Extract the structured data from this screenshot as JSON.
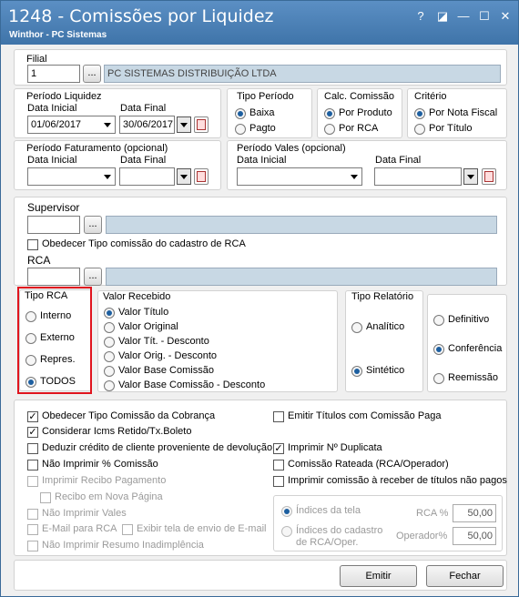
{
  "window": {
    "title": "1248 - Comissões por Liquidez",
    "subtitle": "Winthor - PC Sistemas",
    "help": "?",
    "restore": "◪",
    "minimize": "—",
    "maximize": "☐",
    "close": "✕"
  },
  "filial": {
    "label": "Filial",
    "code": "1",
    "ellipsis": "...",
    "name": "PC SISTEMAS DISTRIBUIÇÃO LTDA"
  },
  "periodo_liquidez": {
    "label": "Período Liquidez",
    "start_label": "Data Inicial",
    "start": "01/06/2017",
    "end_label": "Data Final",
    "end": "30/06/2017"
  },
  "tipo_periodo": {
    "label": "Tipo Período",
    "options": [
      "Baixa",
      "Pagto"
    ],
    "selected": 0
  },
  "calc_comissao": {
    "label": "Calc. Comissão",
    "options": [
      "Por Produto",
      "Por RCA"
    ],
    "selected": 0
  },
  "criterio": {
    "label": "Critério",
    "options": [
      "Por Nota Fiscal",
      "Por Título"
    ],
    "selected": 0
  },
  "periodo_faturamento": {
    "label": "Período Faturamento  (opcional)",
    "start_label": "Data Inicial",
    "end_label": "Data Final"
  },
  "periodo_vales": {
    "label": "Período Vales  (opcional)",
    "start_label": "Data Inicial",
    "end_label": "Data Final"
  },
  "supervisor": {
    "label": "Supervisor",
    "ellipsis": "...",
    "obedecer": "Obedecer Tipo comissão do cadastro de RCA"
  },
  "rca": {
    "label": "RCA",
    "ellipsis": "..."
  },
  "tipo_rca": {
    "label": "Tipo RCA",
    "options": [
      "Interno",
      "Externo",
      "Repres.",
      "TODOS"
    ],
    "selected": 3
  },
  "valor_recebido": {
    "label": "Valor Recebido",
    "options": [
      "Valor Título",
      "Valor Original",
      "Valor Tít. - Desconto",
      "Valor Orig. - Desconto",
      "Valor Base Comissão",
      "Valor Base Comissão - Desconto"
    ],
    "selected": 0
  },
  "tipo_relatorio": {
    "label": "Tipo Relatório",
    "options": [
      "Analítico",
      "Sintético"
    ],
    "selected": 1
  },
  "modo": {
    "options": [
      "Definitivo",
      "Conferência",
      "Reemissão"
    ],
    "selected": 1
  },
  "checks": {
    "c1": "Obedecer Tipo Comissão da Cobrança",
    "c2": "Considerar Icms Retido/Tx.Boleto",
    "c3": "Deduzir crédito de cliente proveniente de devolução",
    "c4": "Não Imprimir % Comissão",
    "c5": "Imprimir Recibo Pagamento",
    "c6": "Recibo em Nova Página",
    "c7": "Não Imprimir Vales",
    "c8": "E-Mail para RCA",
    "c9": "Exibir tela de envio de E-mail",
    "c10": "Não Imprimir Resumo Inadimplência",
    "r1": "Emitir Títulos com Comissão Paga",
    "r2": "Imprimir Nº Duplicata",
    "r3": "Comissão Rateada (RCA/Operador)",
    "r4": "Imprimir comissão à receber de títulos não pagos"
  },
  "indices": {
    "opt1": "Índices da tela",
    "opt2_line1": "Índices do cadastro",
    "opt2_line2": "de RCA/Oper.",
    "rca_label": "RCA %",
    "rca_value": "50,00",
    "oper_label": "Operador%",
    "oper_value": "50,00"
  },
  "buttons": {
    "emitir": "Emitir",
    "fechar": "Fechar"
  },
  "colors": {
    "titlebar": "#4a7fb3",
    "highlight": "#e0141e",
    "radio_selected": "#1d5fa0"
  }
}
